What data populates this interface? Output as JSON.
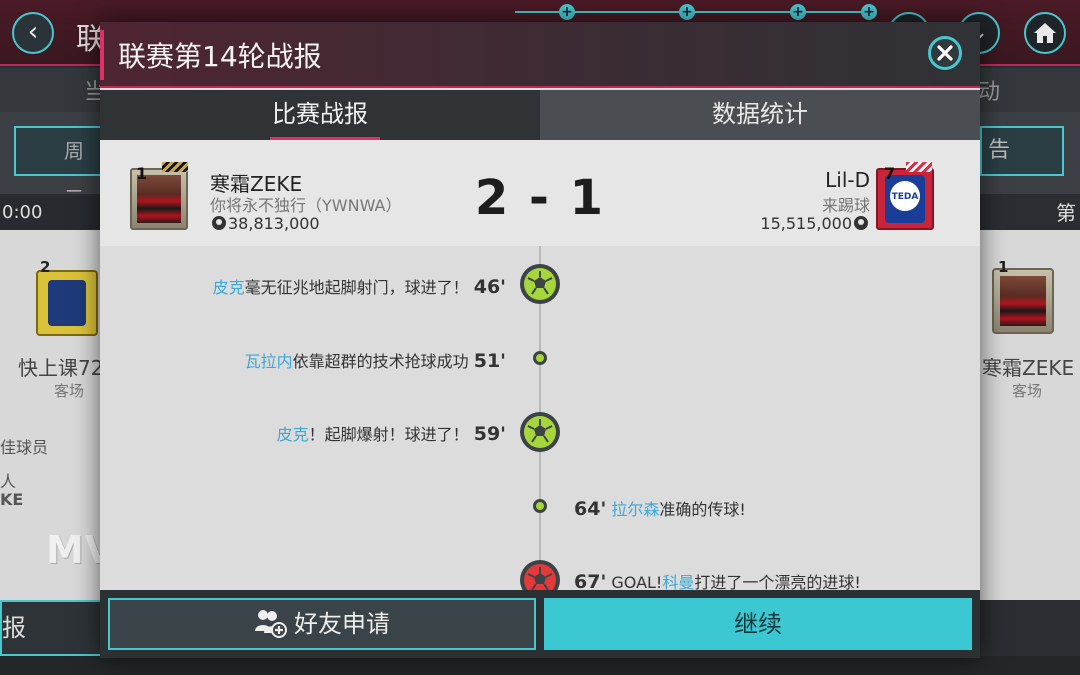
{
  "background": {
    "title": "联",
    "tab_left": "当",
    "tab_right": "动",
    "day_button": "周二",
    "right_button": "告",
    "time": "0:00",
    "time_right": "第",
    "left_card": {
      "badge_num": "2",
      "name": "快上课72",
      "venue": "客场"
    },
    "right_card": {
      "badge_num": "1",
      "name": "寒霜ZEKE",
      "venue": "客场"
    },
    "left_panel_lines": [
      "佳球员",
      "人",
      "KE"
    ],
    "mvp_text": "MV",
    "bottom_left_label": "报"
  },
  "modal": {
    "title": "联赛第14轮战报",
    "tabs": [
      {
        "label": "比赛战报",
        "active": true
      },
      {
        "label": "数据统计",
        "active": false
      }
    ],
    "home": {
      "card_num": "1",
      "name": "寒霜ZEKE",
      "team": "你将永不独行（YWNWA）",
      "value": "38,813,000"
    },
    "away": {
      "card_num": "7",
      "name": "Lil-D",
      "team": "来踢球",
      "value": "15,515,000",
      "crest_text": "TEDA"
    },
    "score": "2 - 1",
    "events": [
      {
        "side": "left",
        "type": "goal",
        "minute": "46'",
        "player": "皮克",
        "text": "毫无征兆地起脚射门，球进了！"
      },
      {
        "side": "left",
        "type": "action",
        "minute": "51'",
        "player": "瓦拉内",
        "text": "依靠超群的技术抢球成功"
      },
      {
        "side": "left",
        "type": "goal",
        "minute": "59'",
        "player": "皮克",
        "text": "！起脚爆射！球进了！"
      },
      {
        "side": "right",
        "type": "action",
        "minute": "64'",
        "player": "拉尔森",
        "text": "准确的传球!"
      },
      {
        "side": "right",
        "type": "goal",
        "minute": "67'",
        "prefix": "GOAL!",
        "player": "科曼",
        "text": "打进了一个漂亮的进球!"
      }
    ],
    "buttons": {
      "friend_request": "好友申请",
      "continue": "继续"
    }
  },
  "colors": {
    "accent_cyan": "#3cc8d2",
    "accent_pink": "#e0306a",
    "player_name": "#3aa8d8",
    "home_goal_ball": "#a6d63a",
    "away_goal_ball": "#e23a3a"
  }
}
